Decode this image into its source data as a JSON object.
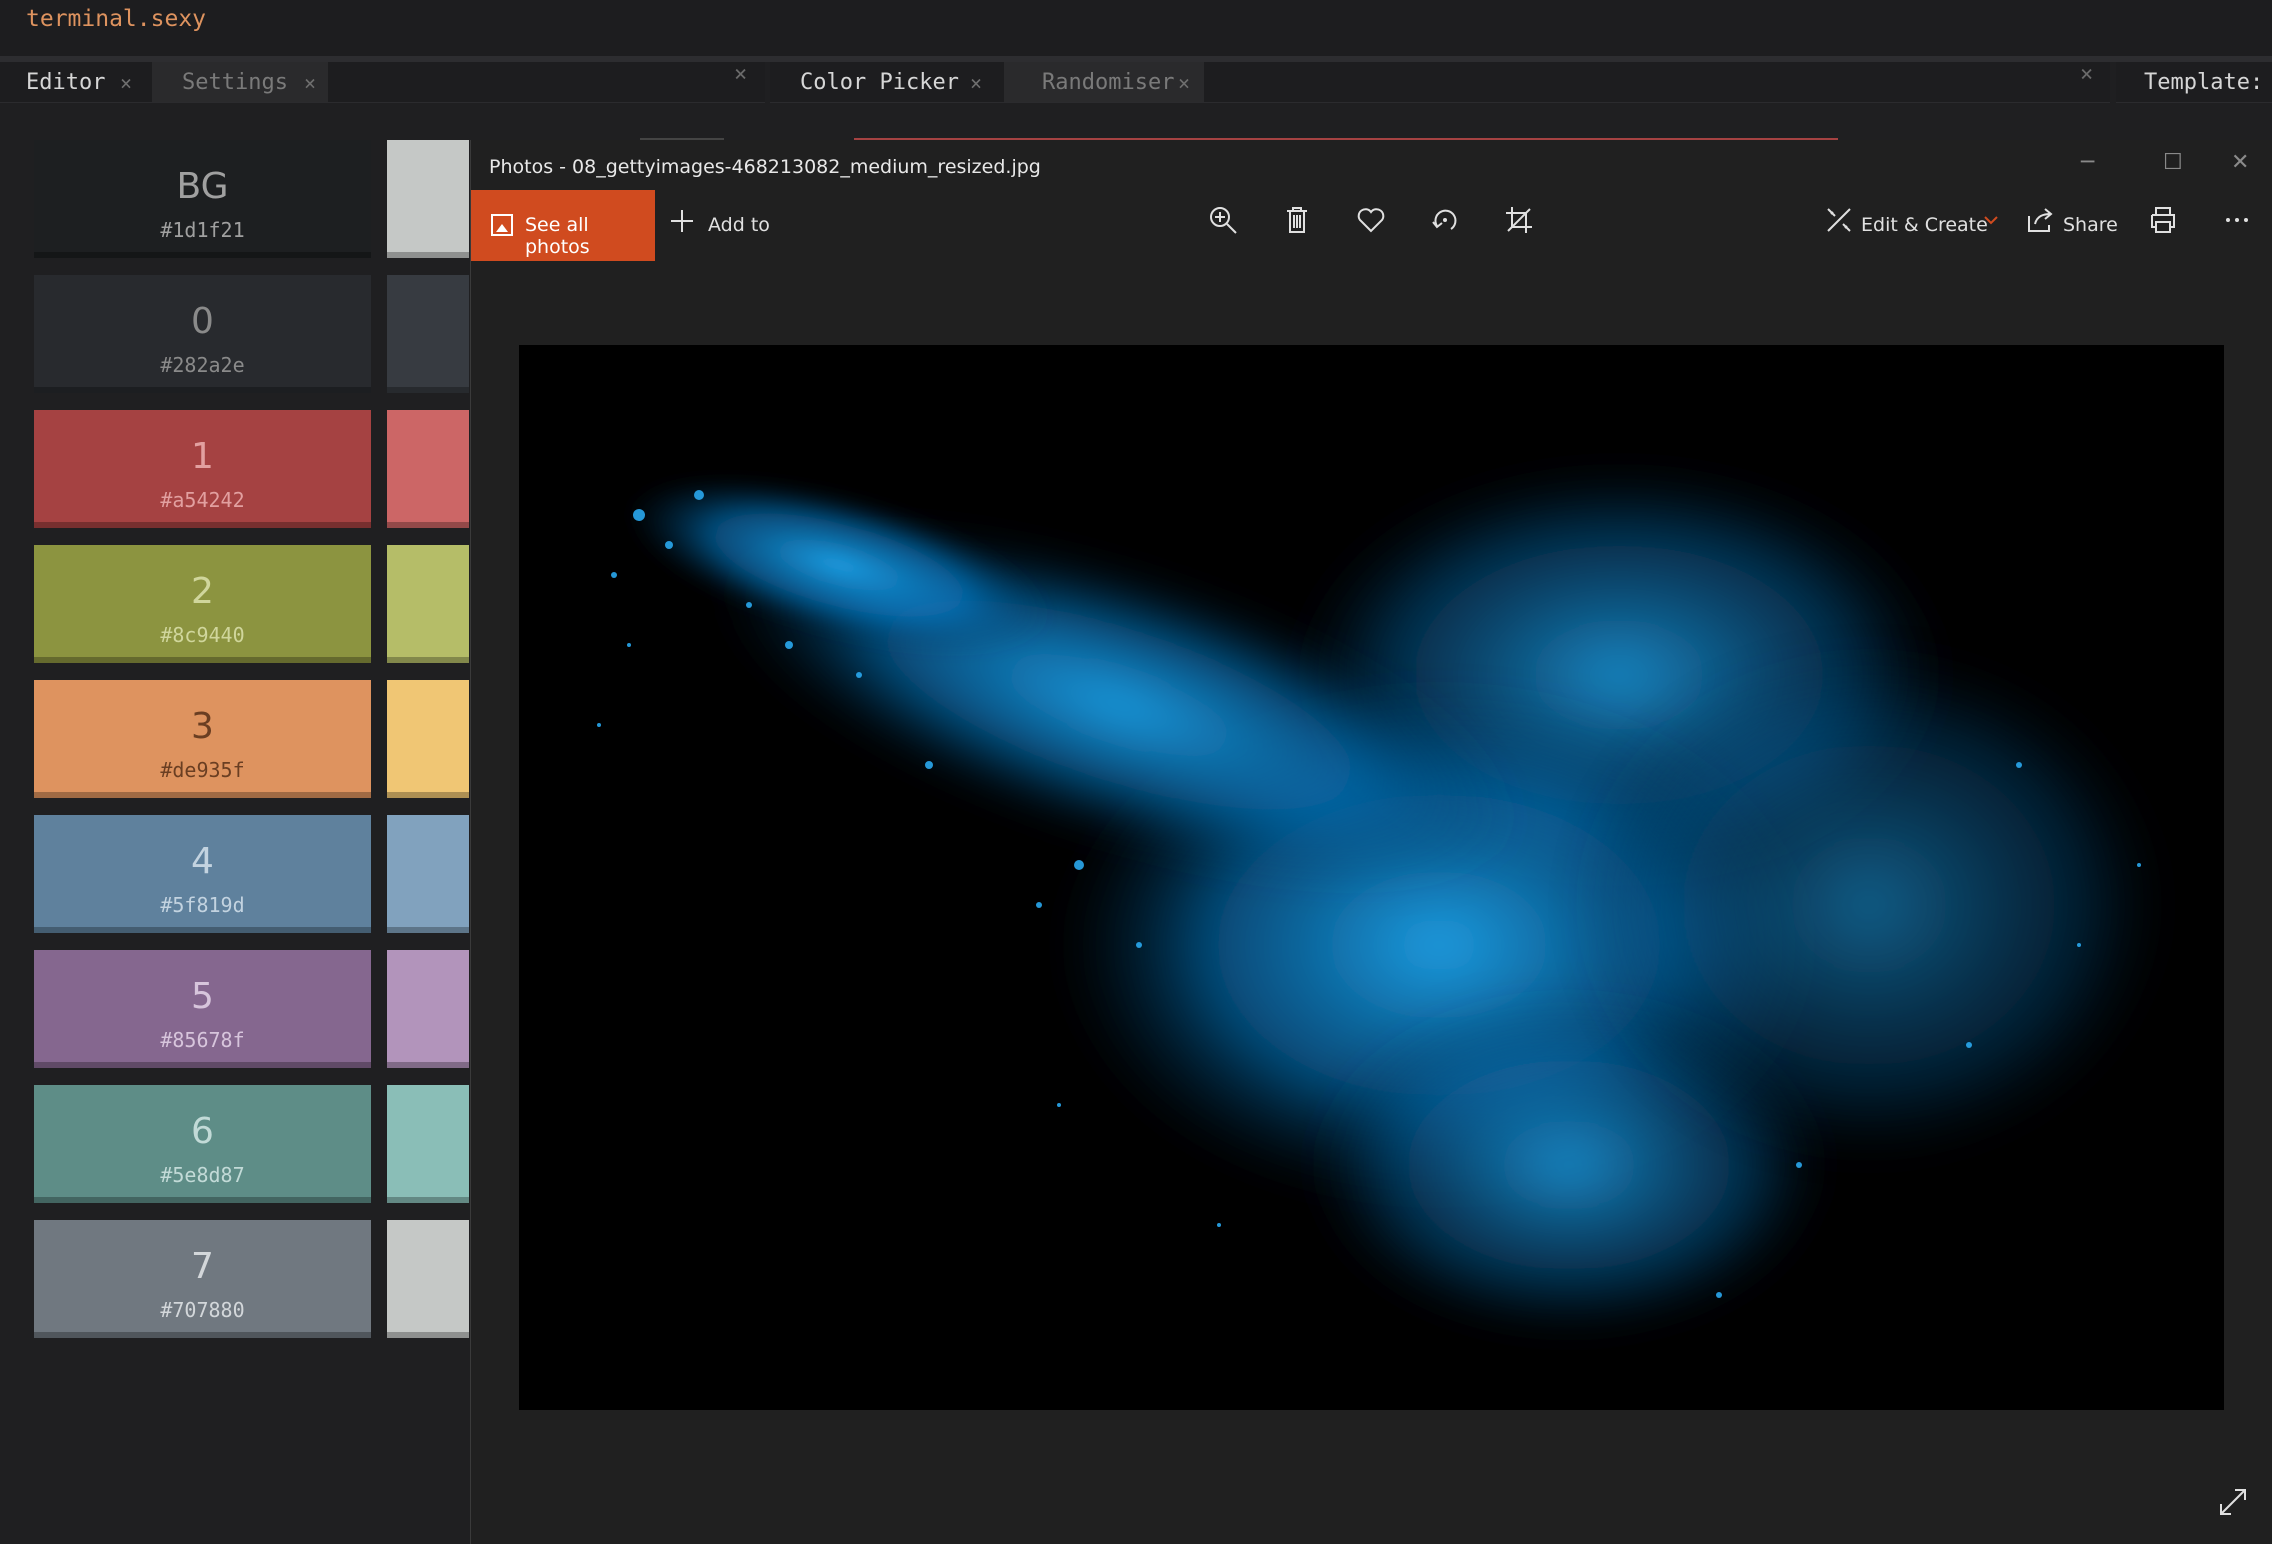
{
  "app": {
    "name": "terminal.sexy"
  },
  "tabs_left": [
    {
      "label": "Editor",
      "close": "×",
      "active": true
    },
    {
      "label": "Settings",
      "close": "×",
      "active": false
    }
  ],
  "tabs_mid": [
    {
      "label": "Color Picker",
      "close": "×",
      "active": true
    },
    {
      "label": "Randomiser",
      "close": "×",
      "active": false
    }
  ],
  "tabs_right": [
    {
      "label": "Template:",
      "active": true
    }
  ],
  "pane_close": "×",
  "swatches": [
    {
      "label": "BG",
      "hex": "#1d1f21",
      "bg": "#1d1f21",
      "text": "#a0a0a0",
      "bright": "#c5c8c6"
    },
    {
      "label": "0",
      "hex": "#282a2e",
      "bg": "#282a2e",
      "text": "#8a8a8a",
      "bright": "#373b41"
    },
    {
      "label": "1",
      "hex": "#a54242",
      "bg": "#a54242",
      "text": "#e2a0a0",
      "bright": "#cc6666"
    },
    {
      "label": "2",
      "hex": "#8c9440",
      "bg": "#8c9440",
      "text": "#d0d69c",
      "bright": "#b5bd68"
    },
    {
      "label": "3",
      "hex": "#de935f",
      "bg": "#de935f",
      "text": "#6a3e22",
      "bright": "#f0c674"
    },
    {
      "label": "4",
      "hex": "#5f819d",
      "bg": "#5f819d",
      "text": "#c3d3e0",
      "bright": "#81a2be"
    },
    {
      "label": "5",
      "hex": "#85678f",
      "bg": "#85678f",
      "text": "#d7c5dc",
      "bright": "#b294bb"
    },
    {
      "label": "6",
      "hex": "#5e8d87",
      "bg": "#5e8d87",
      "text": "#c2dad7",
      "bright": "#8abeb7"
    },
    {
      "label": "7",
      "hex": "#707880",
      "bg": "#707880",
      "text": "#d3d7da",
      "bright": "#c5c8c6"
    }
  ],
  "photos": {
    "title": "Photos - 08_gettyimages-468213082_medium_resized.jpg",
    "see_all": "See all photos",
    "add_to": "Add to",
    "edit_create": "Edit & Create",
    "share": "Share",
    "window_controls": {
      "minimize": "─",
      "maximize": "☐",
      "close": "✕"
    },
    "accent": "#d04b1f",
    "tools": [
      "zoom-icon",
      "delete-icon",
      "favorite-icon",
      "rotate-icon",
      "crop-icon",
      "print-icon",
      "more-icon",
      "expand-icon"
    ]
  }
}
